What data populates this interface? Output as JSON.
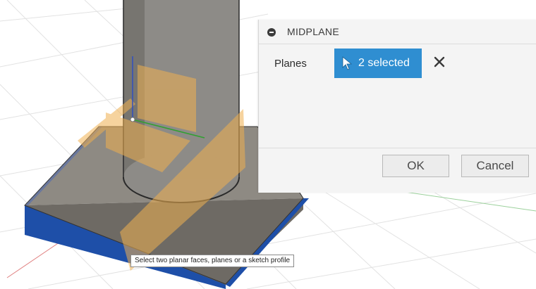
{
  "dialog": {
    "title": "MIDPLANE",
    "planes_label": "Planes",
    "selection_text": "2 selected",
    "ok_label": "OK",
    "cancel_label": "Cancel"
  },
  "tooltip": {
    "text": "Select two planar faces, planes or a sketch profile"
  },
  "icons": {
    "collapse": "minus-circle-icon",
    "cursor": "cursor-arrow-icon",
    "clear": "close-icon"
  },
  "colors": {
    "selection_blue": "#2f8ed1",
    "selected_face_blue": "#1e4fa8",
    "midplane_orange": "#f0b050",
    "x_axis_red": "#e05050",
    "y_axis_green": "#30a030",
    "z_axis_blue": "#3050c0"
  }
}
